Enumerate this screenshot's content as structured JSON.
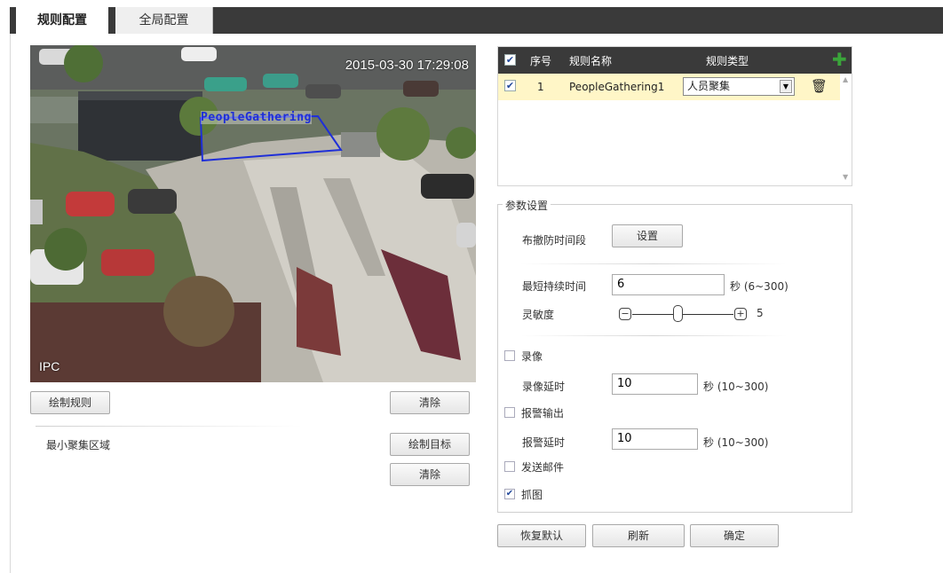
{
  "tabs": [
    {
      "label": "规则配置",
      "active": true
    },
    {
      "label": "全局配置",
      "active": false
    }
  ],
  "video": {
    "timestamp": "2015-03-30 17:29:08",
    "camera_label": "IPC",
    "region_label": "PeopleGathering"
  },
  "left_panel": {
    "draw_rule_button": "绘制规则",
    "clear_button_1": "清除",
    "min_area_label": "最小聚集区域",
    "draw_target_button": "绘制目标",
    "clear_button_2": "清除"
  },
  "rules_table": {
    "headers": {
      "index": "序号",
      "name": "规则名称",
      "type": "规则类型"
    },
    "add_icon": "plus-icon",
    "rows": [
      {
        "checked": true,
        "index": "1",
        "name": "PeopleGathering1",
        "type": "人员聚集"
      }
    ]
  },
  "params": {
    "legend": "参数设置",
    "schedule_label": "布撤防时间段",
    "schedule_button": "设置",
    "min_duration_label": "最短持续时间",
    "min_duration_value": "6",
    "min_duration_unit": "秒 (6~300)",
    "sensitivity_label": "灵敏度",
    "sensitivity_value": "5",
    "sensitivity_range": [
      1,
      10
    ],
    "record": {
      "label": "录像",
      "checked": false
    },
    "record_delay_label": "录像延时",
    "record_delay_value": "10",
    "record_delay_unit": "秒 (10~300)",
    "alarm_out": {
      "label": "报警输出",
      "checked": false
    },
    "alarm_delay_label": "报警延时",
    "alarm_delay_value": "10",
    "alarm_delay_unit": "秒 (10~300)",
    "send_email": {
      "label": "发送邮件",
      "checked": false
    },
    "snapshot": {
      "label": "抓图",
      "checked": true
    }
  },
  "footer": {
    "restore_button": "恢复默认",
    "refresh_button": "刷新",
    "ok_button": "确定"
  },
  "colors": {
    "header_bg": "#3a3a3a",
    "selected_row_bg": "#fff6c7",
    "region_outline": "#1f2fd8",
    "add_icon": "#3aa53a"
  }
}
